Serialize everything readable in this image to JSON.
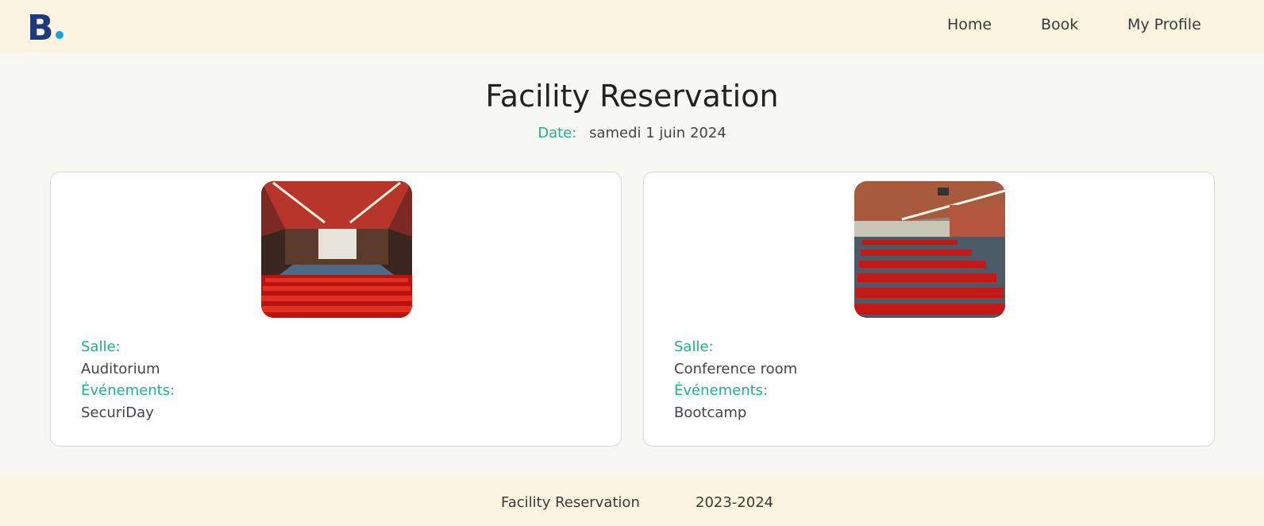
{
  "nav": {
    "logo_text": "B",
    "links": [
      "Home",
      "Book",
      "My Profile"
    ]
  },
  "header": {
    "title": "Facility Reservation",
    "date_label": "Date:",
    "date_value": "samedi 1 juin 2024"
  },
  "cards": [
    {
      "image": "auditorium-photo",
      "room_label": "Salle:",
      "room_value": "Auditorium",
      "events_label": "Événements:",
      "events_value": "SecuriDay"
    },
    {
      "image": "conference-room-photo",
      "room_label": "Salle:",
      "room_value": "Conference room",
      "events_label": "Événements:",
      "events_value": "Bootcamp"
    }
  ],
  "footer": {
    "name": "Facility Reservation",
    "year": "2023-2024"
  },
  "colors": {
    "header_bg": "#f9f3e0",
    "page_bg": "#f8f8f2",
    "accent_label": "#1fb08a",
    "logo_b": "#1f3a7a",
    "logo_dot": "#1aa3d6"
  }
}
